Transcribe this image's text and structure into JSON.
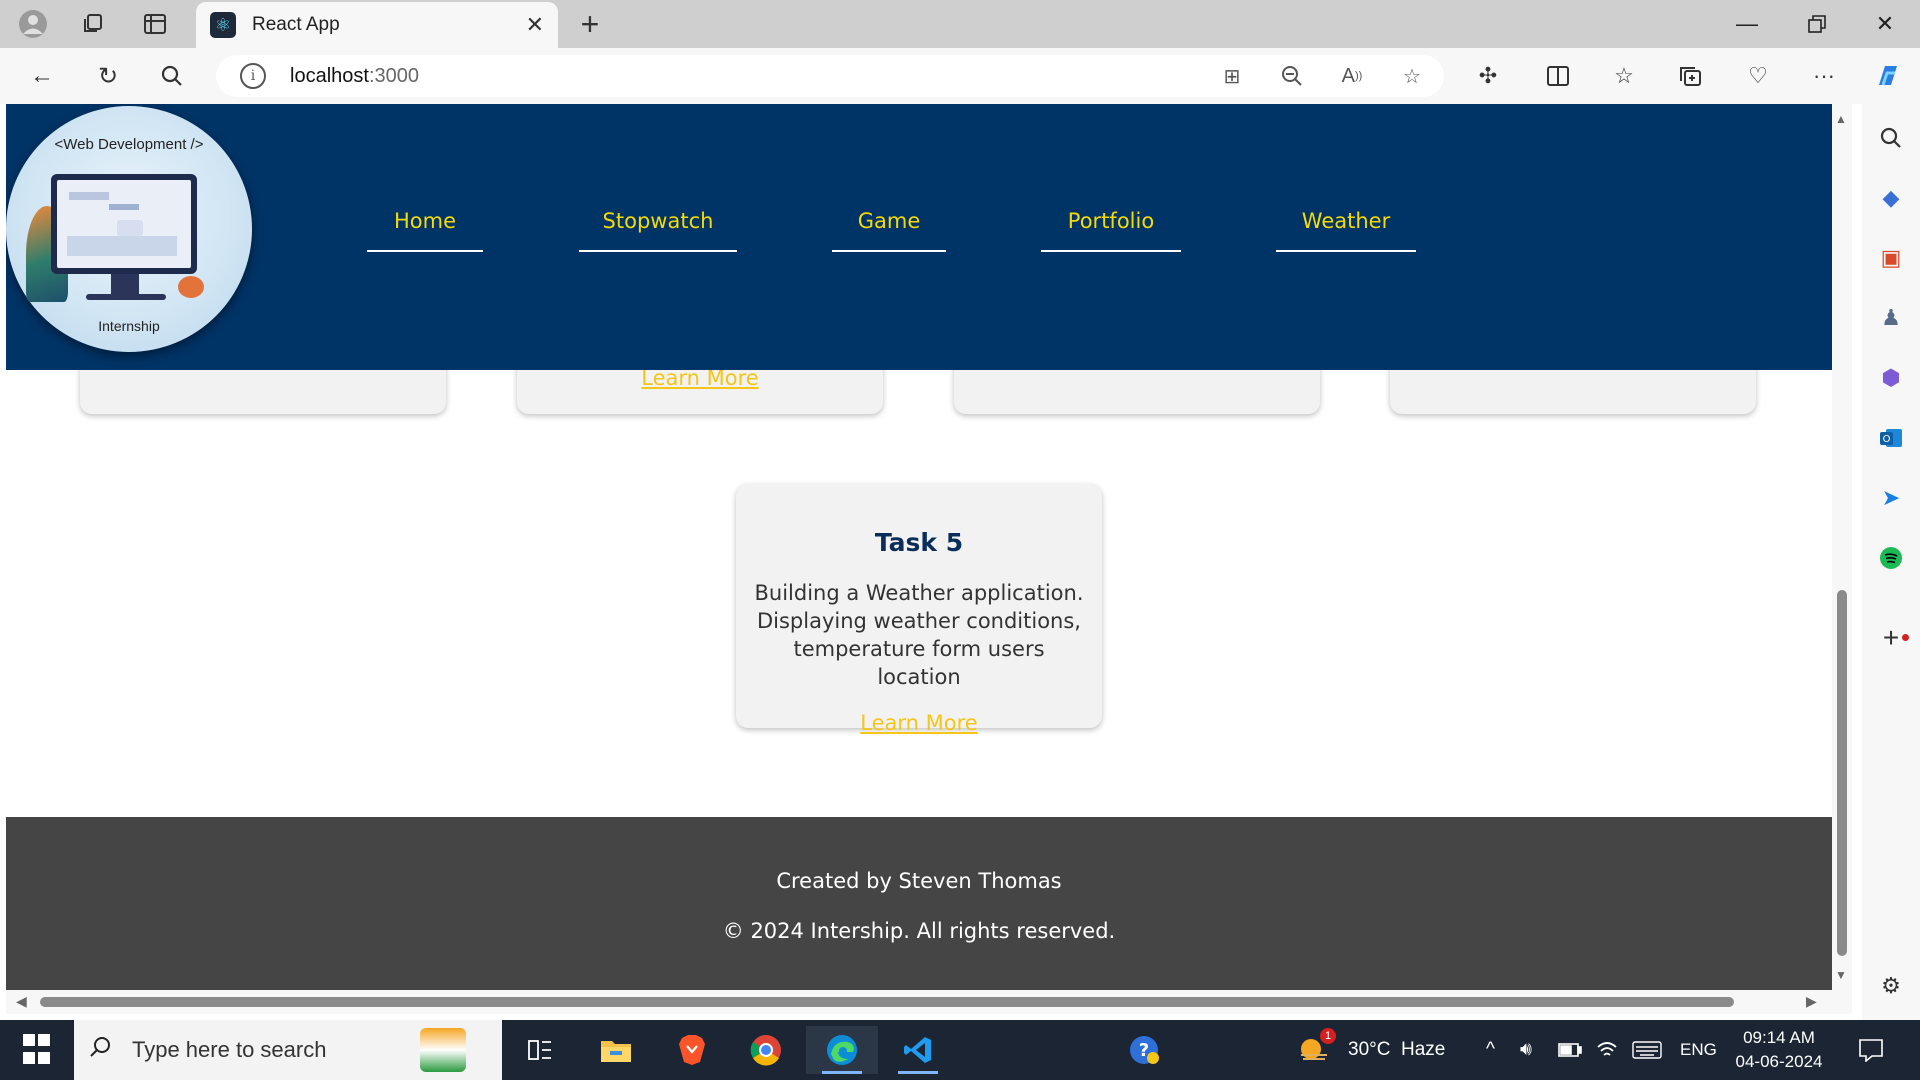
{
  "browser": {
    "tab_title": "React App",
    "url_host": "localhost",
    "url_port": ":3000"
  },
  "site": {
    "logo": {
      "top_text": "<Web Development />",
      "bottom_text": "Internship"
    },
    "nav": [
      "Home",
      "Stopwatch",
      "Game",
      "Portfolio",
      "Weather"
    ],
    "partial_cards": [
      {
        "link": ""
      },
      {
        "link": "Learn More"
      },
      {
        "link": ""
      },
      {
        "link": ""
      }
    ],
    "task_card": {
      "title": "Task 5",
      "description": "Building a Weather application. Displaying weather conditions, temperature form users location",
      "link": "Learn More"
    },
    "footer": {
      "created_by": "Created by Steven Thomas",
      "copyright": "© 2024 Intership. All rights reserved."
    }
  },
  "taskbar": {
    "search_placeholder": "Type here to search",
    "weather_badge": "1",
    "weather": "30°C  Haze",
    "language": "ENG",
    "time": "09:14 AM",
    "date": "04-06-2024"
  },
  "colors": {
    "header_bg": "#003366",
    "nav_link": "#f5d90a",
    "learn_more": "#f5c518",
    "footer_bg": "#454545",
    "task_title": "#0b2d5a"
  }
}
